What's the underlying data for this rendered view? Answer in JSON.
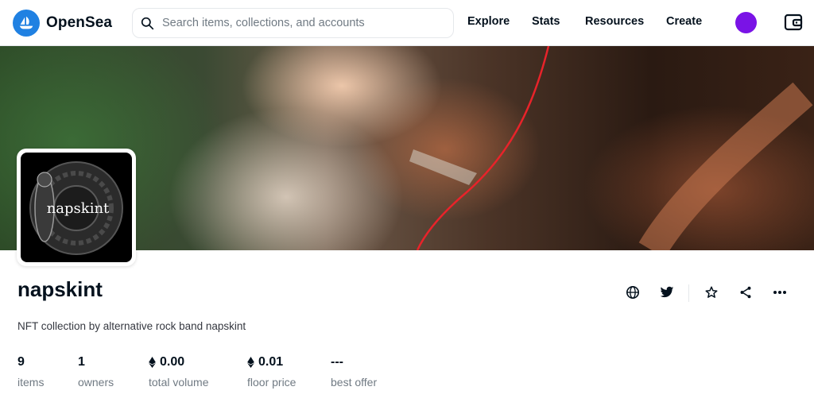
{
  "header": {
    "brand": "OpenSea",
    "search_placeholder": "Search items, collections, and accounts",
    "nav": [
      "Explore",
      "Stats",
      "Resources",
      "Create"
    ],
    "avatar_color": "#7a13e6"
  },
  "collection": {
    "name": "napskint",
    "logo_text": "napskint",
    "description": "NFT collection by alternative rock band napskint",
    "stats": [
      {
        "value": "9",
        "label": "items",
        "eth": false
      },
      {
        "value": "1",
        "label": "owners",
        "eth": false
      },
      {
        "value": "0.00",
        "label": "total volume",
        "eth": true
      },
      {
        "value": "0.01",
        "label": "floor price",
        "eth": true
      },
      {
        "value": "---",
        "label": "best offer",
        "eth": false
      }
    ]
  },
  "colors": {
    "brand": "#2081e2",
    "text": "#04111d",
    "muted": "#707a83"
  },
  "icons": [
    "globe-icon",
    "twitter-icon",
    "star-icon",
    "share-icon",
    "more-icon"
  ]
}
